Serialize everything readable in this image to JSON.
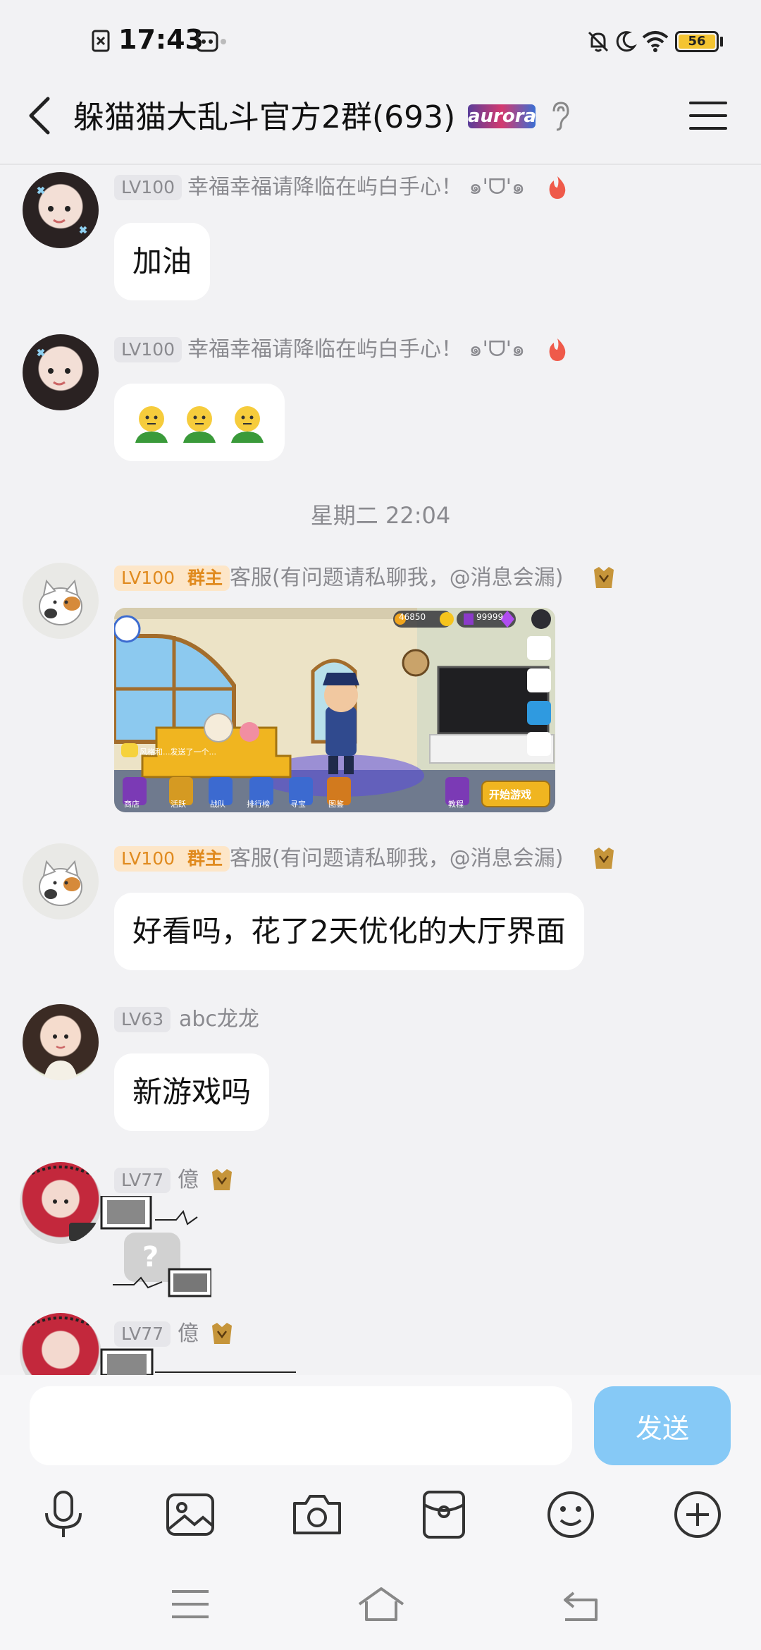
{
  "status_bar": {
    "time": "17:43",
    "battery": "56"
  },
  "header": {
    "title": "躲猫猫大乱斗官方2群(693)",
    "logo_text": "aurora"
  },
  "messages": [
    {
      "level": "LV100",
      "role_tag": "",
      "sender": "幸福幸福请降临在屿白手心！ ๑'ᗜ'๑",
      "text": "加油"
    },
    {
      "level": "LV100",
      "role_tag": "",
      "sender": "幸福幸福请降临在屿白手心！ ๑'ᗜ'๑",
      "emojis": [
        "🫥",
        "🫥",
        "🫥"
      ]
    },
    {
      "level": "LV100",
      "role_tag": "群主",
      "sender": "客服(有问题请私聊我，@消息会漏)",
      "image": {
        "coins": "46850",
        "gems": "99999",
        "bottom_buttons": [
          "商店",
          "活跃",
          "战队",
          "排行榜",
          "寻宝",
          "图鉴"
        ],
        "tutorial": "教程",
        "start": "开始游戏",
        "chat_hint": "风格和...发送了一个..."
      }
    },
    {
      "level": "LV100",
      "role_tag": "群主",
      "sender": "客服(有问题请私聊我，@消息会漏)",
      "text": "好看吗，花了2天优化的大厅界面"
    },
    {
      "level": "LV63",
      "role_tag": "",
      "sender": "abc龙龙",
      "text": "新游戏吗"
    },
    {
      "level": "LV77",
      "role_tag": "",
      "sender": "億",
      "sticker_text": "?"
    },
    {
      "level": "LV77",
      "role_tag": "",
      "sender": "億"
    }
  ],
  "time_divider": "星期二  22:04",
  "input": {
    "placeholder": "",
    "send_label": "发送"
  },
  "toolbar": [
    "microphone-icon",
    "image-icon",
    "camera-icon",
    "red-packet-icon",
    "emoji-icon",
    "plus-icon"
  ],
  "nav": [
    "menu-nav-icon",
    "home-nav-icon",
    "back-nav-icon"
  ]
}
